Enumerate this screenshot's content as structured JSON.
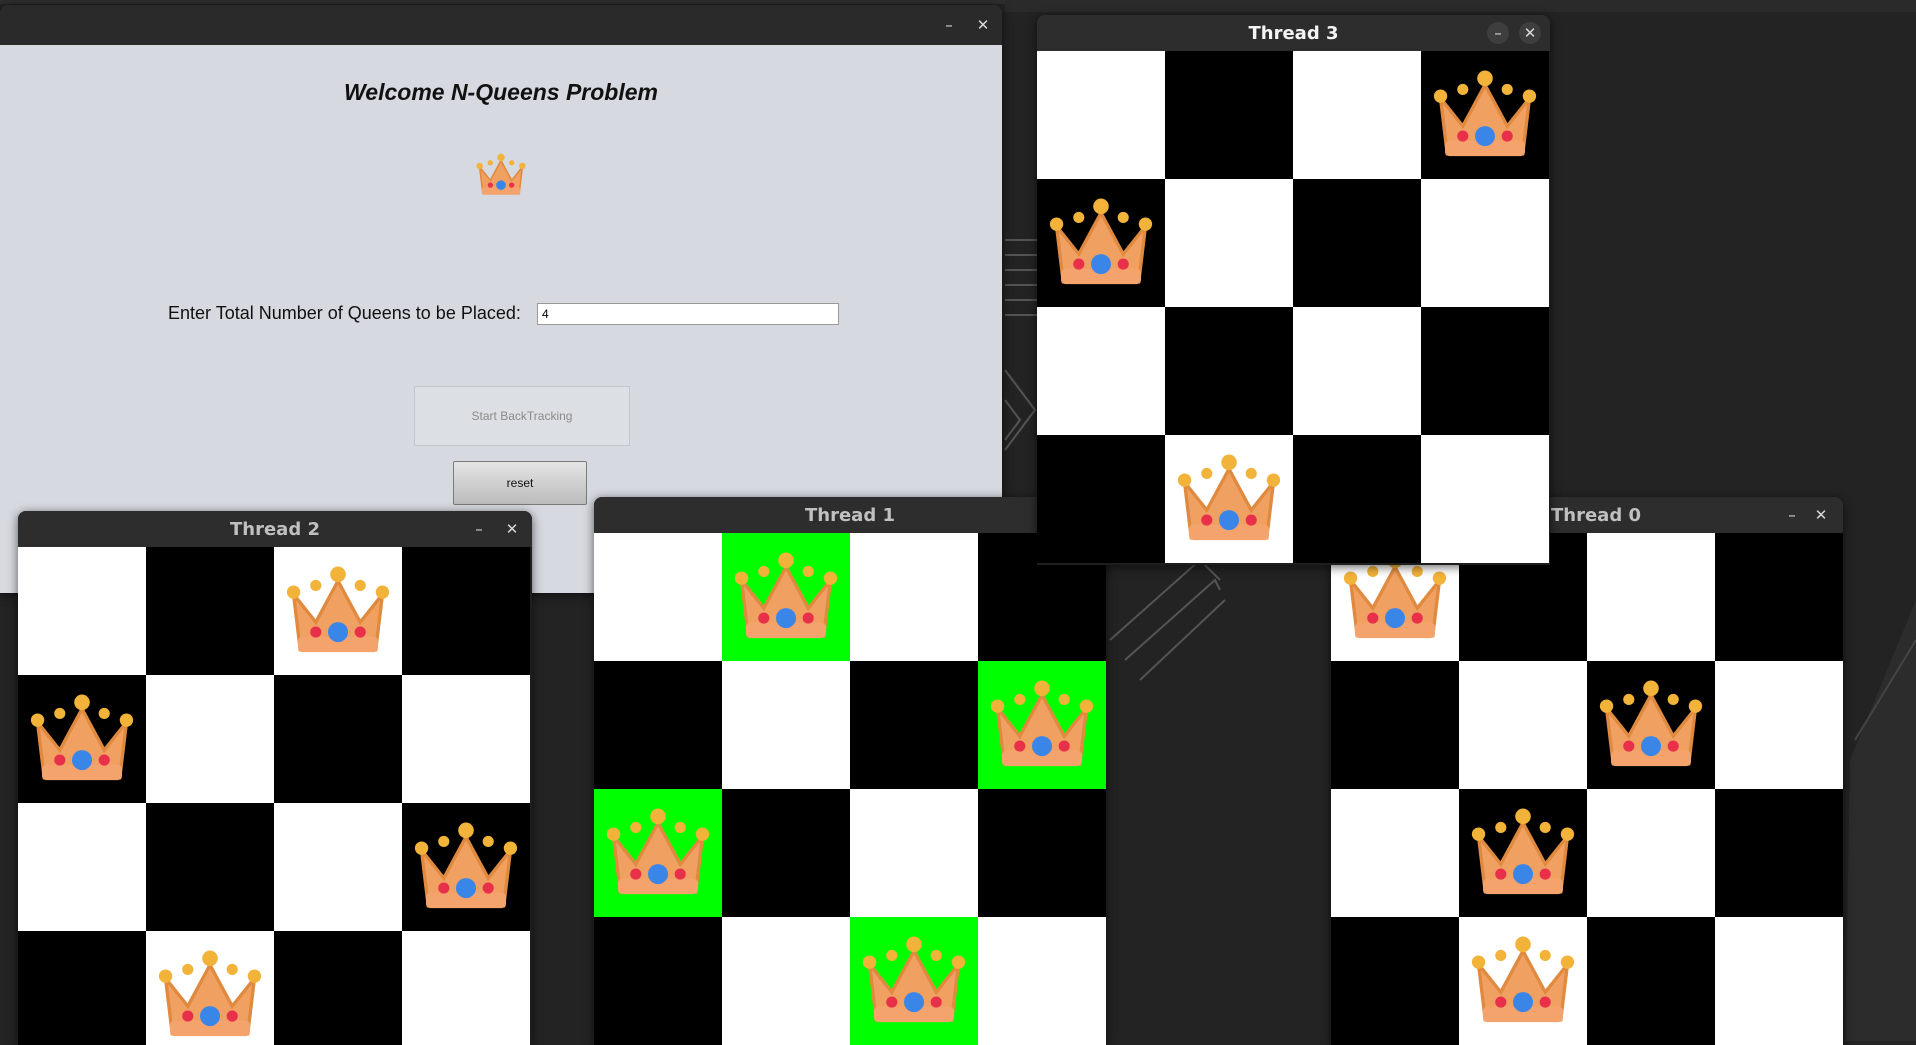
{
  "colors": {
    "desktop": "#232323",
    "titlebar": "#2d2d2d",
    "panel": "#d6d9df",
    "highlight": "#00ff00",
    "dark_square": "#000000",
    "light_square": "#ffffff"
  },
  "main_window": {
    "title": "",
    "heading": "Welcome N-Queens Problem",
    "queens_label": "Enter Total Number of Queens to be Placed:",
    "queens_value": "4",
    "start_button": "Start BackTracking",
    "reset_button": "reset",
    "minimize": "–",
    "close": "✕"
  },
  "boards": [
    {
      "title": "Thread 2",
      "queen_cols": [
        2,
        0,
        3,
        1
      ],
      "highlighted": false
    },
    {
      "title": "Thread 1",
      "queen_cols": [
        1,
        3,
        0,
        2
      ],
      "highlighted": true
    },
    {
      "title": "Thread 0",
      "queen_cols": [
        0,
        2,
        1,
        1
      ],
      "highlighted": false
    },
    {
      "title": "Thread 3",
      "queen_cols": [
        3,
        0,
        -1,
        1
      ],
      "highlighted": false
    }
  ],
  "icons": {
    "queen": "crown-icon",
    "minimize": "minimize-icon",
    "close": "close-icon"
  }
}
